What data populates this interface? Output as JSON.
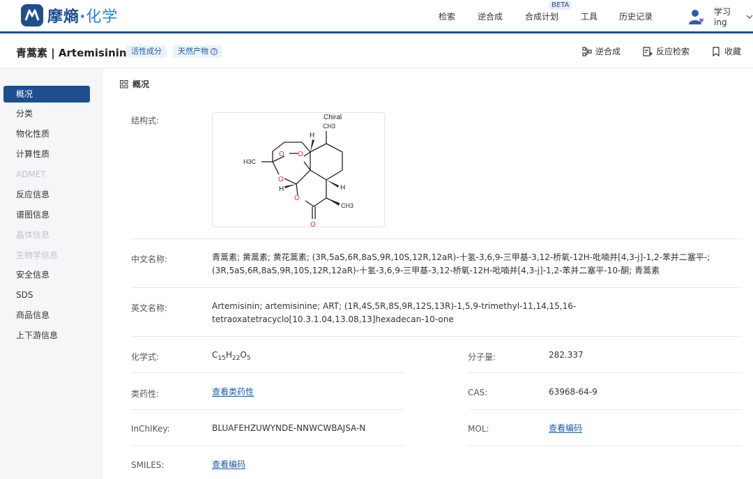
{
  "app": {
    "logo_text_main": "摩熵",
    "logo_text_dot": "·",
    "logo_text_chem": "化学"
  },
  "nav": {
    "items": [
      "检索",
      "逆合成",
      "合成计划",
      "工具",
      "历史记录"
    ],
    "beta_badge": "BETA",
    "username": "学习ing"
  },
  "title_bar": {
    "title": "青蒿素 | Artemisinin",
    "tags": [
      "活性成分",
      "天然产物"
    ],
    "actions": [
      "逆合成",
      "反应检索",
      "收藏"
    ]
  },
  "sidebar": {
    "items": [
      {
        "label": "概况",
        "state": "active"
      },
      {
        "label": "分类",
        "state": "normal"
      },
      {
        "label": "物化性质",
        "state": "normal"
      },
      {
        "label": "计算性质",
        "state": "normal"
      },
      {
        "label": "ADMET",
        "state": "disabled"
      },
      {
        "label": "反应信息",
        "state": "normal"
      },
      {
        "label": "谱图信息",
        "state": "normal"
      },
      {
        "label": "晶体信息",
        "state": "disabled"
      },
      {
        "label": "生物学信息",
        "state": "disabled"
      },
      {
        "label": "安全信息",
        "state": "normal"
      },
      {
        "label": "SDS",
        "state": "normal"
      },
      {
        "label": "商品信息",
        "state": "normal"
      },
      {
        "label": "上下游信息",
        "state": "normal"
      }
    ]
  },
  "overview": {
    "section_title": "概况",
    "structure_label": "结构式:",
    "structure": {
      "chiral_label": "Chiral",
      "atom_labels": [
        "CH3",
        "H3C",
        "O",
        "O",
        "O",
        "O",
        "O",
        "H",
        "H",
        "H",
        "CH3"
      ]
    },
    "chinese_name_label": "中文名称:",
    "chinese_name_value": "青蒿素; 黄蒿素; 黄花蒿素; (3R,5aS,6R,8aS,9R,10S,12R,12aR)-十氢-3,6,9-三甲基-3,12-桥氧-12H-吡喃并[4,3-j]-1,2-苯并二塞平-; (3R,5aS,6R,8aS,9R,10S,12R,12aR)-十氢-3,6,9-三甲基-3,12-桥氧-12H-吡喃并[4,3-j]-1,2-苯并二塞平-10-酮; 青蒿素",
    "english_name_label": "英文名称:",
    "english_name_value": "Artemisinin; artemisinine; ART; (1R,4S,5R,8S,9R,12S,13R)-1,5,9-trimethyl-11,14,15,16-tetraoxatetracyclo[10.3.1.04,13.08,13]hexadecan-10-one",
    "formula_label": "化学式:",
    "formula": {
      "c": "C",
      "c_n": "15",
      "h": "H",
      "h_n": "22",
      "o": "O",
      "o_n": "5"
    },
    "mw_label": "分子量:",
    "mw_value": "282.337",
    "druglike_label": "类药性:",
    "druglike_link": "查看类药性",
    "cas_label": "CAS:",
    "cas_value": "63968-64-9",
    "inchikey_label": "InChIKey:",
    "inchikey_value": "BLUAFEHZUWYNDE-NNWCWBAJSA-N",
    "mol_label": "MOL:",
    "mol_link": "查看编码",
    "smiles_label": "SMILES:",
    "smiles_link": "查看编码"
  },
  "colors": {
    "brand": "#1d4f8f",
    "link": "#1d5aa6",
    "oxygen": "#e03030"
  }
}
